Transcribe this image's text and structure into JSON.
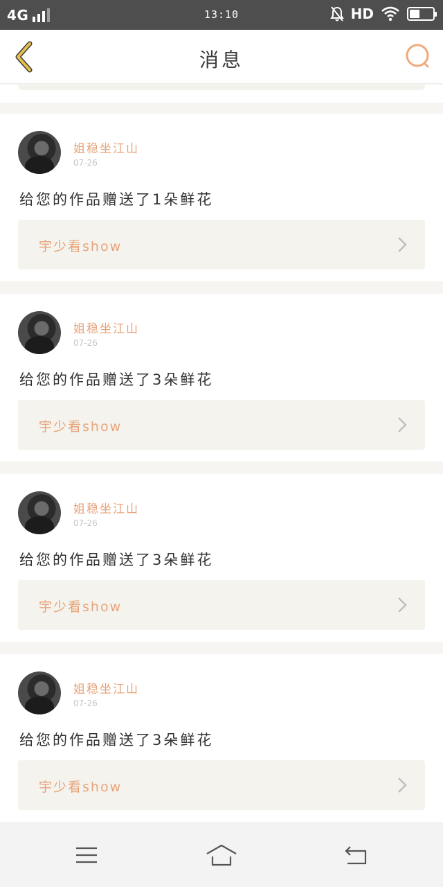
{
  "status_bar": {
    "network": "4G",
    "time": "13:10",
    "hd": "HD"
  },
  "nav": {
    "title": "消息"
  },
  "messages": [
    {
      "user": "姐稳坐江山",
      "date": "07-26",
      "text": "给您的作品赠送了1朵鲜花",
      "work_title": "宇少看show"
    },
    {
      "user": "姐稳坐江山",
      "date": "07-26",
      "text": "给您的作品赠送了3朵鲜花",
      "work_title": "宇少看show"
    },
    {
      "user": "姐稳坐江山",
      "date": "07-26",
      "text": "给您的作品赠送了3朵鲜花",
      "work_title": "宇少看show"
    },
    {
      "user": "姐稳坐江山",
      "date": "07-26",
      "text": "给您的作品赠送了3朵鲜花",
      "work_title": "宇少看show"
    }
  ],
  "colors": {
    "accent": "#e8a37a",
    "back_icon": "#e0b84a",
    "card_bg": "#f4f3ed"
  },
  "icons": [
    "back-icon",
    "search-icon",
    "menu-icon",
    "home-icon",
    "return-icon",
    "chevron-right-icon"
  ]
}
